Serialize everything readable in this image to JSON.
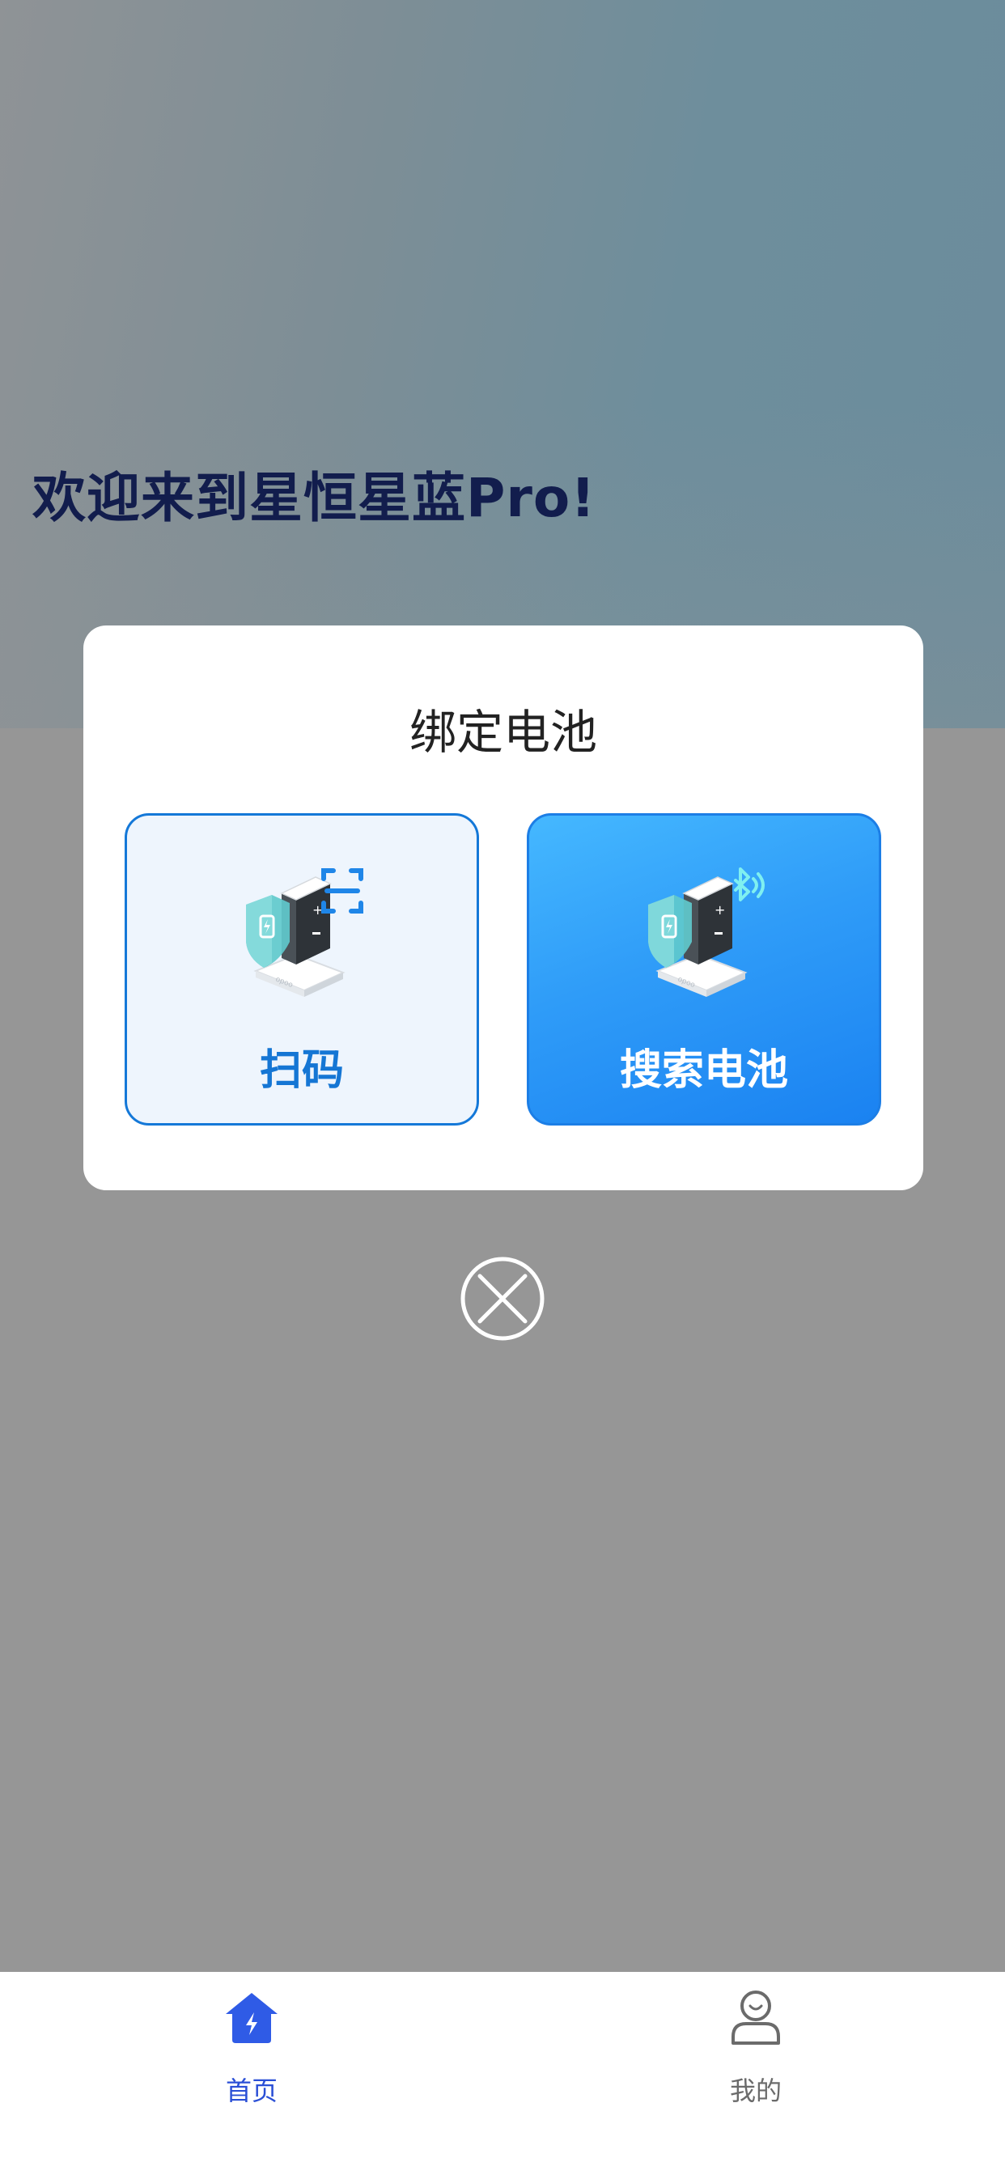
{
  "welcome": {
    "title": "欢迎来到星恒星蓝Pro!"
  },
  "dialog": {
    "title": "绑定电池",
    "options": [
      {
        "label": "扫码",
        "icon": "battery-scan-icon"
      },
      {
        "label": "搜索电池",
        "icon": "battery-bluetooth-icon"
      }
    ],
    "close_icon": "close-circle-icon"
  },
  "tabbar": {
    "items": [
      {
        "label": "首页",
        "icon": "home-bolt-icon",
        "active": true,
        "color": "#2a4fd6"
      },
      {
        "label": "我的",
        "icon": "user-icon",
        "active": false,
        "color": "#6b6b6b"
      }
    ]
  },
  "colors": {
    "accent": "#1a82f1",
    "scan_border": "#1478d8",
    "title_dark": "#121d4d"
  }
}
